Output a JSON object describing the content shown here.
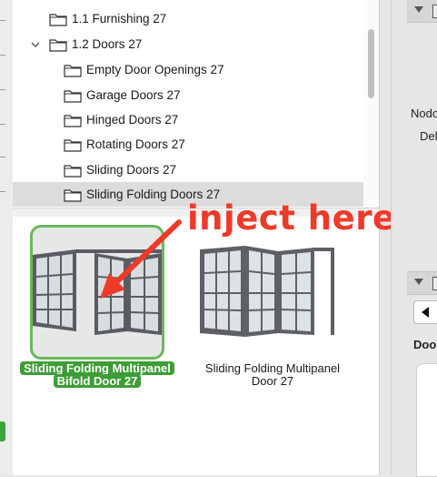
{
  "tree": {
    "items": [
      {
        "label": "1.1 Furnishing 27",
        "level": 1,
        "expanded": false,
        "selected": false
      },
      {
        "label": "1.2 Doors 27",
        "level": 1,
        "expanded": true,
        "selected": false
      },
      {
        "label": "Empty Door Openings 27",
        "level": 2,
        "expanded": false,
        "selected": false
      },
      {
        "label": "Garage Doors 27",
        "level": 2,
        "expanded": false,
        "selected": false
      },
      {
        "label": "Hinged Doors 27",
        "level": 2,
        "expanded": false,
        "selected": false
      },
      {
        "label": "Rotating Doors 27",
        "level": 2,
        "expanded": false,
        "selected": false
      },
      {
        "label": "Sliding Doors 27",
        "level": 2,
        "expanded": false,
        "selected": false
      },
      {
        "label": "Sliding Folding Doors 27",
        "level": 2,
        "expanded": false,
        "selected": true
      }
    ]
  },
  "gallery": {
    "items": [
      {
        "line1": "Sliding Folding Multipanel",
        "line2": "Bifold Door 27",
        "selected": true
      },
      {
        "line1": "Sliding Folding Multipanel",
        "line2": "Door 27",
        "selected": false
      }
    ]
  },
  "annotation": {
    "text": "inject here",
    "color": "#ee3a28"
  },
  "right_panel": {
    "label_1": "Nodo",
    "label_2": "Del",
    "label_3": "Door"
  },
  "colors": {
    "selection_green": "#3d9d36",
    "tile_border": "#69b85a",
    "row_selected": "#dcdcdc"
  }
}
